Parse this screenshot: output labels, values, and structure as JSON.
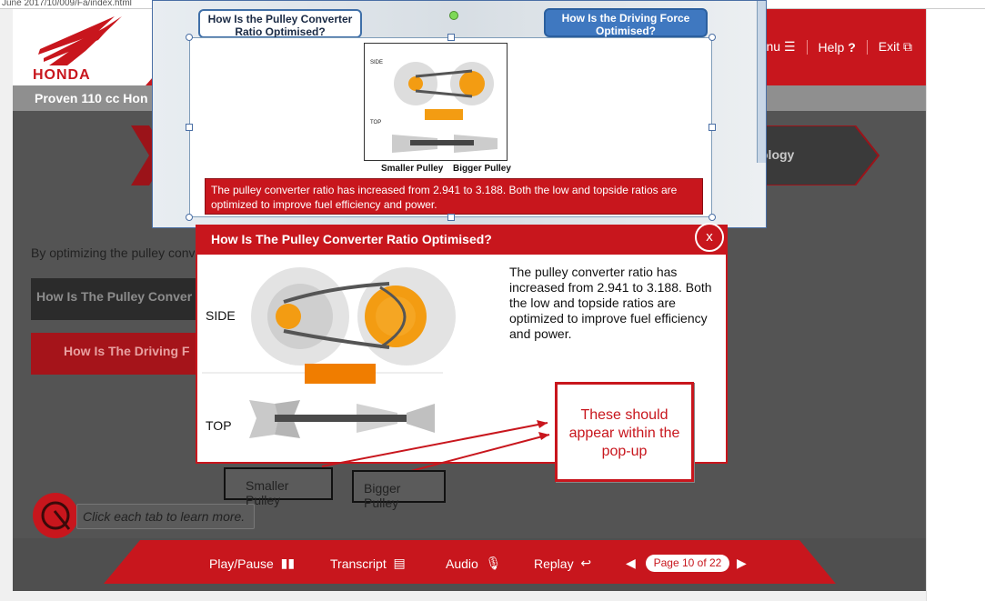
{
  "browser": {
    "url_fragment": "June 2017/10/009/Fa/index.html"
  },
  "header": {
    "brand": "HONDA",
    "menu_label": "nu",
    "help_label": "Help",
    "exit_label": "Exit",
    "course_title": "Proven 110 cc Hon"
  },
  "course": {
    "tech_tab_label": "ology",
    "intro_text": "By optimizing the pulley conv",
    "tab_pulley": "How Is The Pulley Conver",
    "tab_driving": "How Is The Driving F",
    "instruction": "Click each tab to learn more."
  },
  "footer": {
    "play_pause": "Play/Pause",
    "transcript": "Transcript",
    "audio": "Audio",
    "replay": "Replay",
    "page_indicator": "Page 10 of 22"
  },
  "editor": {
    "button_pulley": "How Is the Pulley Converter Ratio Optimised?",
    "button_driving": "How Is the Driving Force Optimised?",
    "thumb_side": "SIDE",
    "thumb_top": "TOP",
    "caption_small": "Smaller Pulley",
    "caption_big": "Bigger Pulley",
    "text_block": "The pulley converter ratio has increased from 2.941 to 3.188. Both the low and topside ratios are optimized to improve fuel efficiency and power."
  },
  "popup": {
    "title": "How Is The Pulley Converter Ratio Optimised?",
    "close": "x",
    "side_label": "SIDE",
    "top_label": "TOP",
    "description": "The pulley converter ratio has increased from 2.941 to 3.188. Both the low and topside ratios are optimized to improve fuel efficiency and power."
  },
  "annotations": {
    "callout": "These should appear within the pop-up",
    "smaller_pulley": "Smaller Pulley",
    "bigger_pulley": "Bigger Pulley"
  },
  "colors": {
    "brand_red": "#c8161d",
    "dark_gray": "#545454",
    "accent_blue": "#3f78c0",
    "pulley_orange": "#f39c12"
  }
}
